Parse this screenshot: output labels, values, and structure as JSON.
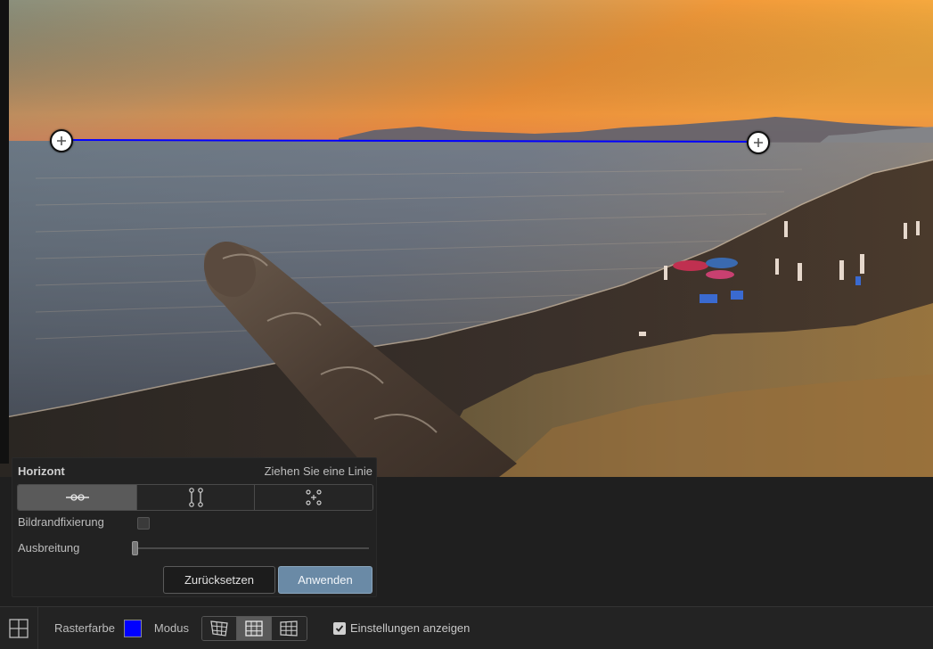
{
  "panel": {
    "title": "Horizont",
    "hint": "Ziehen Sie eine Linie",
    "modes": [
      {
        "icon": "horizon-line-icon",
        "active": true
      },
      {
        "icon": "vertical-lines-icon",
        "active": false
      },
      {
        "icon": "four-points-icon",
        "active": false
      }
    ],
    "border_fix_label": "Bildrandfixierung",
    "border_fix_checked": false,
    "spread_label": "Ausbreitung",
    "spread_value": 0,
    "reset_label": "Zurücksetzen",
    "apply_label": "Anwenden"
  },
  "horizon_line": {
    "color": "#0000ff",
    "handle_icon": "plus-icon"
  },
  "toolbar": {
    "grid_toggle_icon": "grid-icon",
    "grid_color_label": "Rasterfarbe",
    "grid_color": "#0000ff",
    "mode_label": "Modus",
    "grid_modes": [
      {
        "icon": "perspective-left-grid-icon",
        "active": false
      },
      {
        "icon": "rectangular-grid-icon",
        "active": true
      },
      {
        "icon": "perspective-right-grid-icon",
        "active": false
      }
    ],
    "show_settings_label": "Einstellungen anzeigen",
    "show_settings_checked": true
  },
  "colors": {
    "accent_button": "#6a8aa6",
    "panel_bg": "#222222",
    "toolbar_bg": "#232323"
  }
}
